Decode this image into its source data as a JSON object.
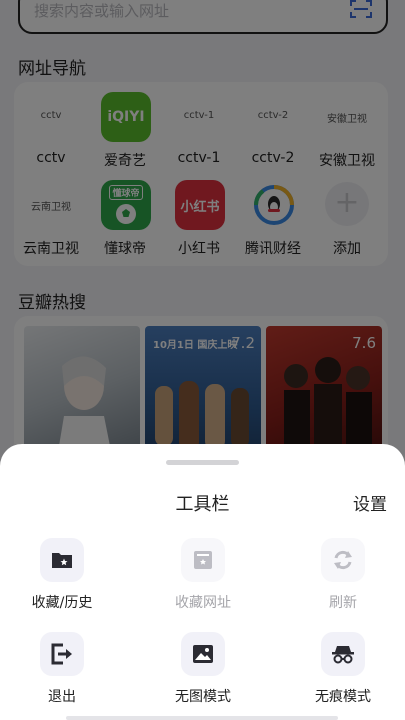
{
  "search": {
    "placeholder": "搜索内容或输入网址"
  },
  "nav_section": {
    "title": "网址导航",
    "items": [
      {
        "logo": "cctv",
        "label": "cctv"
      },
      {
        "logo": "iQIYI",
        "label": "爱奇艺"
      },
      {
        "logo": "cctv-1",
        "label": "cctv-1"
      },
      {
        "logo": "cctv-2",
        "label": "cctv-2"
      },
      {
        "logo": "安徽卫视",
        "label": "安徽卫视"
      },
      {
        "logo": "云南卫视",
        "label": "云南卫视"
      },
      {
        "logo": "懂球帝",
        "label": "懂球帝"
      },
      {
        "logo": "小红书",
        "label": "小红书"
      },
      {
        "logo": "",
        "label": "腾讯财经"
      },
      {
        "logo": "+",
        "label": "添加"
      }
    ]
  },
  "douban_section": {
    "title": "豆瓣热搜",
    "posters": [
      {
        "score": ""
      },
      {
        "score": "7.2",
        "headline": "10月1日 国庆上映"
      },
      {
        "score": "7.6"
      }
    ]
  },
  "toolbar": {
    "title": "工具栏",
    "settings_label": "设置",
    "tools": [
      {
        "label": "收藏/历史",
        "icon": "folder-star-icon",
        "enabled": true
      },
      {
        "label": "收藏网址",
        "icon": "bookmark-page-icon",
        "enabled": false
      },
      {
        "label": "刷新",
        "icon": "refresh-icon",
        "enabled": false
      },
      {
        "label": "退出",
        "icon": "exit-icon",
        "enabled": true
      },
      {
        "label": "无图模式",
        "icon": "image-icon",
        "enabled": true
      },
      {
        "label": "无痕模式",
        "icon": "incognito-icon",
        "enabled": true
      }
    ]
  },
  "colors": {
    "iqiyi": "#5bbf2c",
    "dongqiudi": "#2ea84a",
    "xiaohongshu": "#e0303f",
    "icon_dark": "#2b2b33",
    "icon_disabled": "#bdbdc4"
  }
}
